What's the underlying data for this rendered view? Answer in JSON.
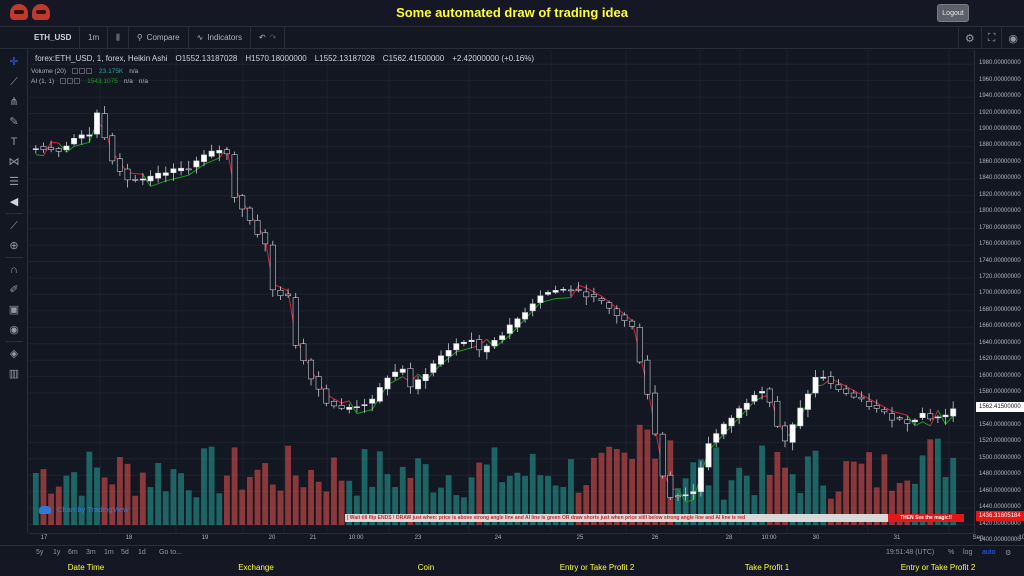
{
  "header": {
    "title": "Some automated draw of trading idea",
    "logout_label": "Logout",
    "brand_color": "#ffff33"
  },
  "toolbar": {
    "symbol": "ETH_USD",
    "interval": "1m",
    "compare_label": "Compare",
    "indicators_label": "Indicators",
    "icons": [
      "candle-style-icon",
      "compare-icon",
      "indicators-icon",
      "undo-icon",
      "redo-icon",
      "settings-icon",
      "fullscreen-icon",
      "camera-icon"
    ]
  },
  "left_tools": [
    "crosshair-icon",
    "trend-line-icon",
    "pitchfork-icon",
    "brush-icon",
    "text-icon",
    "pattern-icon",
    "fib-icon",
    "arrow-left-icon",
    "ruler-icon",
    "zoom-in-icon",
    "magnet-icon",
    "lock-drawing-icon",
    "lock-icon",
    "eye-icon",
    "layers-icon",
    "trash-icon"
  ],
  "legend": {
    "symbol_line": "forex:ETH_USD, 1, forex, Heikin Ashi",
    "open": "O1552.13187028",
    "high": "H1570.18000000",
    "low": "L1552.13187028",
    "close": "C1562.41500000",
    "change": "+2.42000000 (+0.16%)",
    "volume_label": "Volume (20)",
    "volume_value": "23.175K",
    "volume_na": "n/a",
    "ai_label": "AI (1, 1)",
    "ai_value": "1543.1075",
    "ai_na1": "n/a",
    "ai_na2": "n/a"
  },
  "attribution": "Chart by TradingView",
  "price_scale": {
    "ticks": [
      "1980.00000000",
      "1960.00000000",
      "1940.00000000",
      "1920.00000000",
      "1900.00000000",
      "1880.00000000",
      "1860.00000000",
      "1840.00000000",
      "1820.00000000",
      "1800.00000000",
      "1780.00000000",
      "1760.00000000",
      "1740.00000000",
      "1720.00000000",
      "1700.00000000",
      "1680.00000000",
      "1660.00000000",
      "1640.00000000",
      "1620.00000000",
      "1600.00000000",
      "1580.00000000",
      "1540.00000000",
      "1520.00000000",
      "1500.00000000",
      "1480.00000000",
      "1460.00000000",
      "1440.00000000",
      "1420.00000000",
      "1400.00000000"
    ],
    "current_price": "1562.41500000",
    "marker_price": "1436.31605184",
    "marker_color": "#e01818"
  },
  "time_axis": [
    "17",
    "18",
    "19",
    "20",
    "21",
    "10:00",
    "23",
    "24",
    "25",
    "26",
    "28",
    "10:00",
    "30",
    "31",
    "Sep",
    "10:00"
  ],
  "bottom_bar": {
    "ranges": [
      "5y",
      "1y",
      "6m",
      "3m",
      "1m",
      "5d",
      "1d"
    ],
    "goto": "Go to...",
    "clock": "19:51:48 (UTC)",
    "percent": "%",
    "log": "log",
    "auto": "auto"
  },
  "banner": {
    "main": "|     Wait till flip ENDS  !    DRAW just when: price is above strong angle line and AI line is green         OR        draw shorts just when price still below strong angle line and AI line is red",
    "end": "THEN See the magic!!"
  },
  "footer": [
    "Date Time",
    "Exchange",
    "Coin",
    "Entry or Take Profit 2",
    "Take Profit 1",
    "Entry or Take Profit 2"
  ],
  "chart_data": {
    "type": "candlestick",
    "style": "Heikin Ashi",
    "ylim": [
      1400,
      1990
    ],
    "x": [
      "17",
      "18",
      "19",
      "20",
      "21",
      "10:00",
      "23",
      "24",
      "25",
      "26",
      "28",
      "10:00",
      "30",
      "31",
      "Sep",
      "10:00"
    ],
    "close_path": [
      [
        0,
        1880
      ],
      [
        3,
        1876
      ],
      [
        5,
        1890
      ],
      [
        7,
        1895
      ],
      [
        8,
        1920
      ],
      [
        9,
        1893
      ],
      [
        10,
        1865
      ],
      [
        12,
        1840
      ],
      [
        14,
        1838
      ],
      [
        17,
        1848
      ],
      [
        20,
        1855
      ],
      [
        22,
        1868
      ],
      [
        24,
        1876
      ],
      [
        25,
        1870
      ],
      [
        26,
        1820
      ],
      [
        28,
        1790
      ],
      [
        30,
        1760
      ],
      [
        31,
        1705
      ],
      [
        33,
        1696
      ],
      [
        34,
        1640
      ],
      [
        36,
        1600
      ],
      [
        38,
        1570
      ],
      [
        40,
        1560
      ],
      [
        42,
        1565
      ],
      [
        44,
        1570
      ],
      [
        46,
        1600
      ],
      [
        48,
        1610
      ],
      [
        49,
        1585
      ],
      [
        51,
        1605
      ],
      [
        53,
        1625
      ],
      [
        55,
        1640
      ],
      [
        57,
        1645
      ],
      [
        58,
        1630
      ],
      [
        60,
        1645
      ],
      [
        62,
        1660
      ],
      [
        64,
        1680
      ],
      [
        66,
        1700
      ],
      [
        68,
        1705
      ],
      [
        70,
        1706
      ],
      [
        72,
        1700
      ],
      [
        74,
        1690
      ],
      [
        76,
        1675
      ],
      [
        78,
        1660
      ],
      [
        79,
        1620
      ],
      [
        80,
        1580
      ],
      [
        81,
        1530
      ],
      [
        82,
        1480
      ],
      [
        83,
        1455
      ],
      [
        84,
        1455
      ],
      [
        86,
        1460
      ],
      [
        87,
        1490
      ],
      [
        88,
        1520
      ],
      [
        90,
        1540
      ],
      [
        92,
        1560
      ],
      [
        94,
        1580
      ],
      [
        95,
        1585
      ],
      [
        96,
        1570
      ],
      [
        97,
        1540
      ],
      [
        98,
        1520
      ],
      [
        99,
        1540
      ],
      [
        100,
        1560
      ],
      [
        101,
        1580
      ],
      [
        102,
        1598
      ],
      [
        103,
        1600
      ],
      [
        104,
        1590
      ],
      [
        106,
        1580
      ],
      [
        108,
        1570
      ],
      [
        110,
        1560
      ],
      [
        112,
        1550
      ],
      [
        114,
        1545
      ],
      [
        116,
        1555
      ],
      [
        117,
        1550
      ],
      [
        119,
        1552
      ],
      [
        120,
        1562
      ]
    ],
    "ai_line_color_up": "#1e9e1e",
    "ai_line_color_down": "#e0203a",
    "volume_colors": [
      "#26a69a",
      "#ef5350"
    ]
  }
}
